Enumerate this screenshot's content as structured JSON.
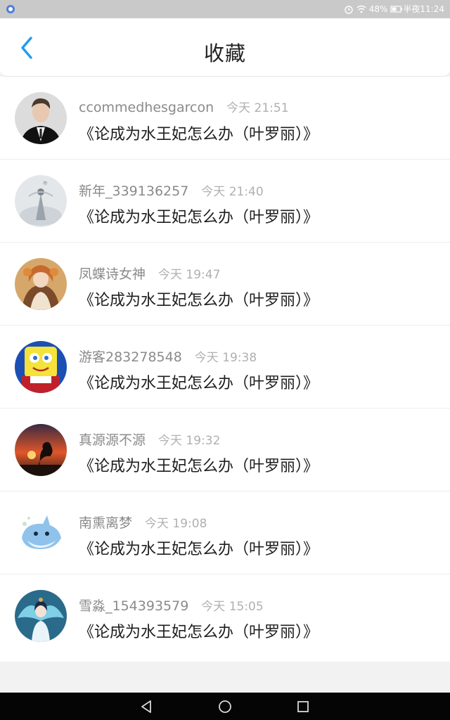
{
  "status_bar": {
    "battery": "48%",
    "time": "半夜11:24"
  },
  "header": {
    "title": "收藏"
  },
  "favorites": [
    {
      "user": "ccommedhesgarcon",
      "time": "今天 21:51",
      "book": "《论成为水王妃怎么办（叶罗丽）》",
      "avatar": "man-in-suit-avatar"
    },
    {
      "user": "新年_339136257",
      "time": "今天 21:40",
      "book": "《论成为水王妃怎么办（叶罗丽）》",
      "avatar": "misty-figure-avatar"
    },
    {
      "user": "凤蝶诗女神",
      "time": "今天 19:47",
      "book": "《论成为水王妃怎么办（叶罗丽）》",
      "avatar": "anime-girl-avatar"
    },
    {
      "user": "游客283278548",
      "time": "今天 19:38",
      "book": "《论成为水王妃怎么办（叶罗丽）》",
      "avatar": "sponge-cartoon-avatar"
    },
    {
      "user": "真源源不源",
      "time": "今天 19:32",
      "book": "《论成为水王妃怎么办（叶罗丽）》",
      "avatar": "sunset-silhouette-avatar"
    },
    {
      "user": "南熏离梦",
      "time": "今天 19:08",
      "book": "《论成为水王妃怎么办（叶罗丽）》",
      "avatar": "cartoon-shark-avatar"
    },
    {
      "user": "雪淼_154393579",
      "time": "今天 15:05",
      "book": "《论成为水王妃怎么办（叶罗丽）》",
      "avatar": "anime-fairy-avatar"
    }
  ],
  "colors": {
    "accent": "#1f9cf0",
    "username": "#8a8a8a",
    "timestamp": "#b0b0b0",
    "title": "#1e1e1e"
  }
}
